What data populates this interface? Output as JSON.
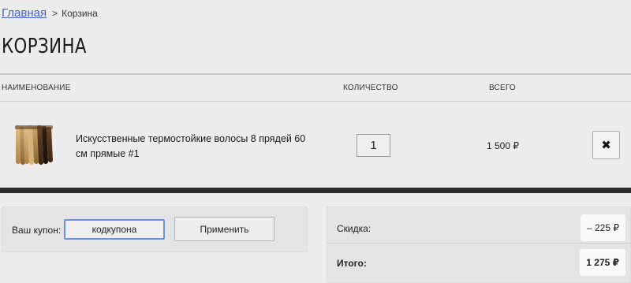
{
  "breadcrumb": {
    "home_link": "Главная",
    "separator": ">",
    "current": "Корзина"
  },
  "page_title": "КОРЗИНА",
  "columns": {
    "name": "НАИМЕНОВАНИЕ",
    "quantity": "КОЛИЧЕСТВО",
    "total": "ВСЕГО"
  },
  "cart_items": [
    {
      "name": "Искусственные термостойкие волосы 8 прядей 60 см прямые #1",
      "quantity": "1",
      "line_total": "1 500 ₽",
      "remove_icon": "close-icon",
      "image": "hair-strands-photo"
    }
  ],
  "coupon": {
    "label": "Ваш купон:",
    "value": "кодкупона",
    "apply_label": "Применить"
  },
  "summary": {
    "discount_label": "Скидка:",
    "discount_value": "– 225 ₽",
    "total_label": "Итого:",
    "total_value": "1 275 ₽"
  },
  "colors": {
    "link": "#4a62c8",
    "background": "#ececec",
    "dark_divider": "#2c2c2c",
    "input_focus_border": "#6d92d8",
    "highlight": "#fafafa"
  }
}
